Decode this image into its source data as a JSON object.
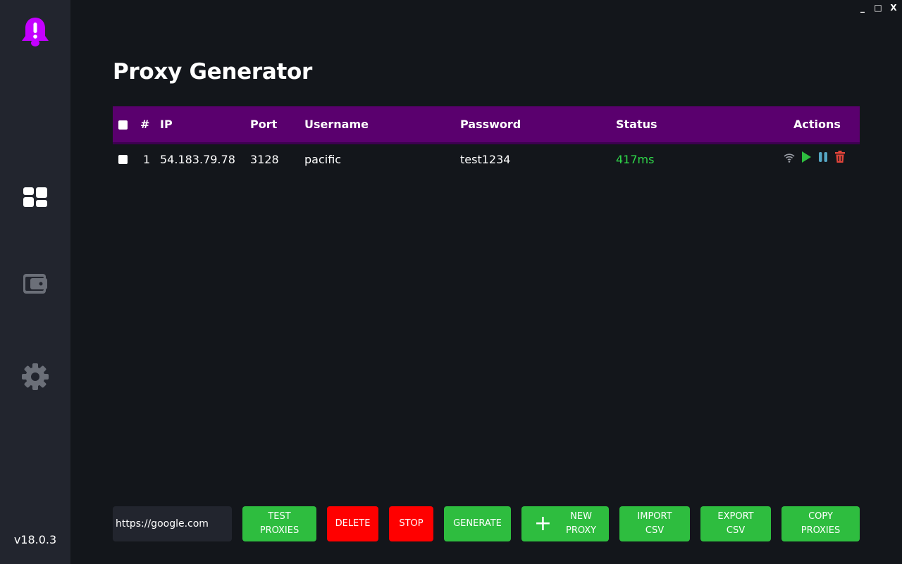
{
  "window": {
    "minimize_label": "_",
    "maximize_label": "□",
    "close_label": "X"
  },
  "sidebar": {
    "logo_icon": "bell-alert-icon",
    "items": [
      {
        "name": "dashboard",
        "icon": "dashboard-icon"
      },
      {
        "name": "wallet",
        "icon": "wallet-icon"
      },
      {
        "name": "settings",
        "icon": "gear-icon"
      }
    ],
    "version": "v18.0.3"
  },
  "page": {
    "title": "Proxy Generator"
  },
  "table": {
    "headers": {
      "num": "#",
      "ip": "IP",
      "port": "Port",
      "username": "Username",
      "password": "Password",
      "status": "Status",
      "actions": "Actions"
    },
    "rows": [
      {
        "num": "1",
        "ip": "54.183.79.78",
        "port": "3128",
        "username": "pacific",
        "password": "test1234",
        "status": "417ms"
      }
    ]
  },
  "bottom": {
    "url_value": "https://google.com",
    "test_label_1": "TEST",
    "test_label_2": "PROXIES",
    "delete_label": "DELETE",
    "stop_label": "STOP",
    "generate_label": "GENERATE",
    "new_plus": "+",
    "new_label_1": "NEW",
    "new_label_2": "PROXY",
    "import_label_1": "IMPORT",
    "import_label_2": "CSV",
    "export_label_1": "EXPORT",
    "export_label_2": "CSV",
    "copy_label_1": "COPY",
    "copy_label_2": "PROXIES"
  },
  "colors": {
    "accent_purple": "#5a006e",
    "logo_purple": "#c400ff",
    "success_green": "#2ebd3f",
    "danger_red": "#ff0000",
    "status_green": "#2fd84a"
  }
}
